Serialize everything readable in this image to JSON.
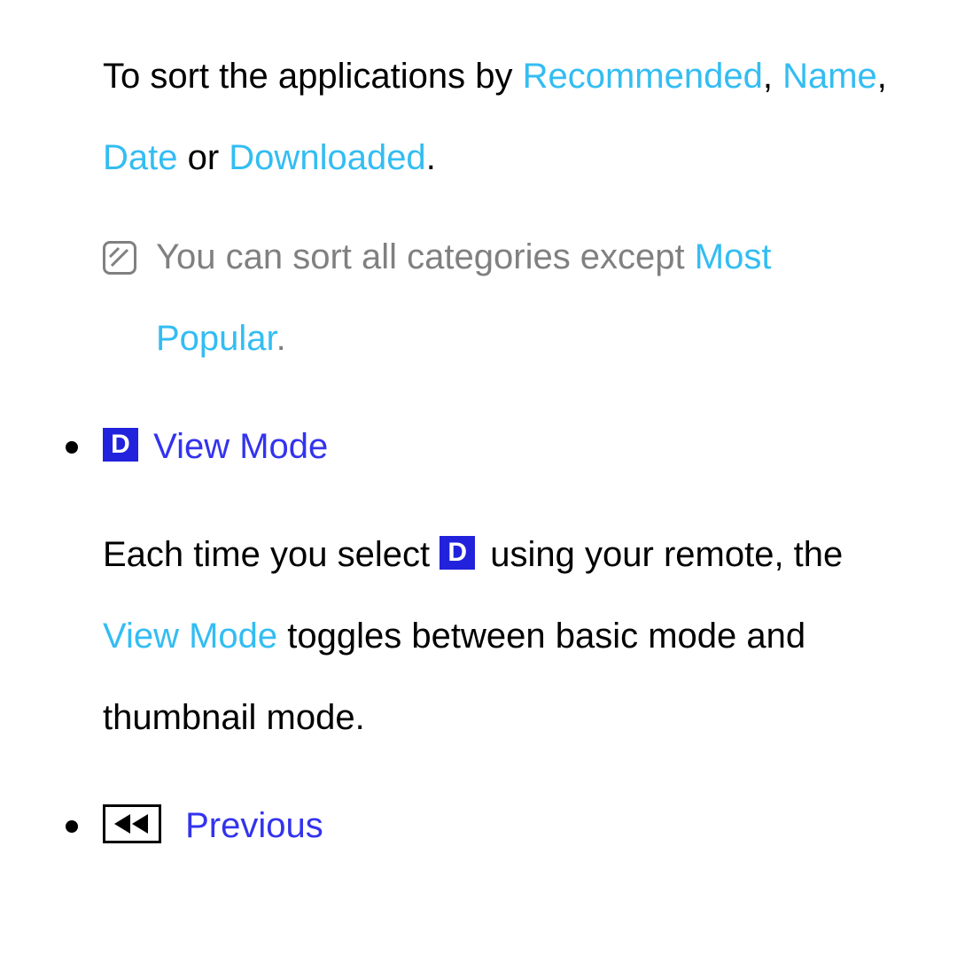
{
  "intro": {
    "prefix": "To sort the applications by ",
    "sort_recommended": "Recommended",
    "sep1": ", ",
    "sort_name": "Name",
    "sep2": ", ",
    "sort_date": "Date",
    "sep3": " or ",
    "sort_downloaded": "Downloaded",
    "suffix": "."
  },
  "note": {
    "prefix": "You can sort all categories except ",
    "highlight": "Most Popular",
    "suffix": "."
  },
  "view_mode": {
    "d_label": "D",
    "title": " View Mode",
    "body_prefix": "Each time you select ",
    "body_d": "D",
    "body_mid": " using your remote, the ",
    "body_highlight": "View Mode",
    "body_suffix": " toggles between basic mode and thumbnail mode."
  },
  "previous": {
    "title": " Previous"
  }
}
